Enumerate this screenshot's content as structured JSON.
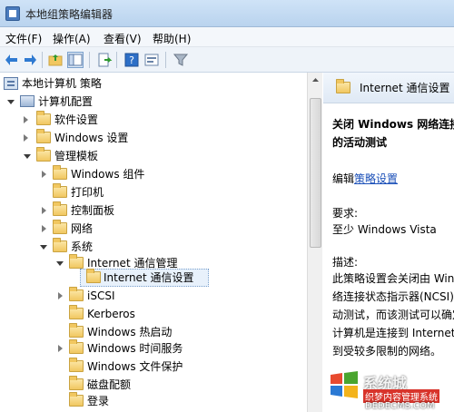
{
  "window": {
    "title": "本地组策略编辑器"
  },
  "menu": [
    "文件(F)",
    "操作(A)",
    "查看(V)",
    "帮助(H)"
  ],
  "toolbar": {
    "buttons": [
      "back-icon",
      "forward-icon",
      "up-folder-icon",
      "show-hide-tree-icon",
      "export-list-icon",
      "help-icon",
      "properties-icon",
      "filter-icon"
    ]
  },
  "tree": {
    "root": "本地计算机 策略",
    "computer_config": "计算机配置",
    "software_settings": "软件设置",
    "windows_settings": "Windows 设置",
    "admin_templates": "管理模板",
    "windows_components": "Windows 组件",
    "printers": "打印机",
    "control_panel": "控制面板",
    "network": "网络",
    "system": "系统",
    "internet_comm_mgmt": "Internet 通信管理",
    "internet_comm_settings": "Internet 通信设置",
    "iscsi": "iSCSI",
    "kerberos": "Kerberos",
    "windows_hot_start": "Windows 热启动",
    "windows_time_service": "Windows 时间服务",
    "windows_file_protection": "Windows 文件保护",
    "disk_quota": "磁盘配额",
    "logon": "登录"
  },
  "details": {
    "header": "Internet 通信设置",
    "policy_title_line1": "关闭 Windows 网络连接",
    "policy_title_line2": "的活动测试",
    "edit_prefix": "编辑",
    "edit_link": "策略设置",
    "requirements_label": "要求:",
    "requirements_value": "至少 Windows Vista",
    "description_label": "描述:",
    "description_lines": [
      "此策略设置会关闭由 Wind",
      "络连接状态指示器(NCSI)打",
      "动测试，而该测试可以确定",
      "计算机是连接到 Internet",
      "到受较多限制的网络。"
    ]
  },
  "watermark": {
    "brand": "系统城",
    "line1": "织梦内容管理系统",
    "line2": "DEDECMS.COM"
  },
  "colors": {
    "accent": "#1a4fb8",
    "folder": "#f1c760",
    "selection": "#e8f1fb"
  }
}
